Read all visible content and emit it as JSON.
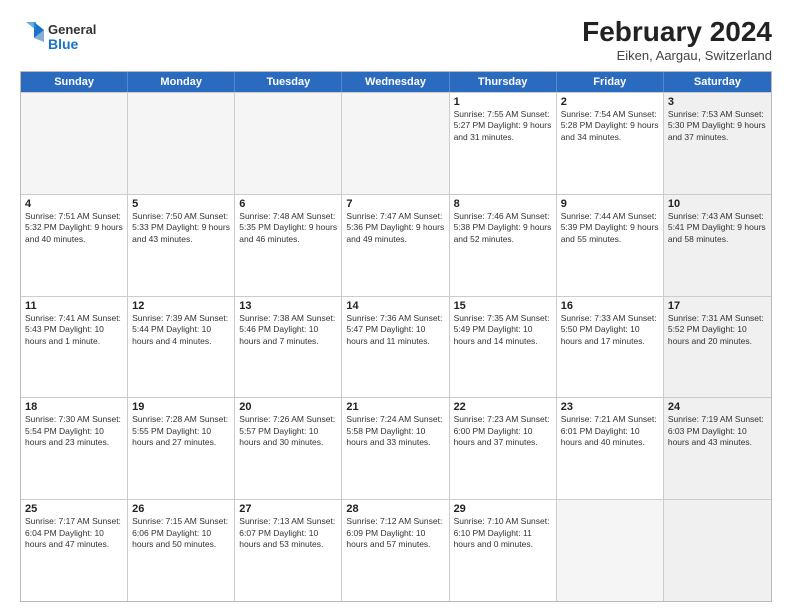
{
  "header": {
    "logo_general": "General",
    "logo_blue": "Blue",
    "month_year": "February 2024",
    "location": "Eiken, Aargau, Switzerland"
  },
  "weekdays": [
    "Sunday",
    "Monday",
    "Tuesday",
    "Wednesday",
    "Thursday",
    "Friday",
    "Saturday"
  ],
  "rows": [
    [
      {
        "day": "",
        "info": "",
        "empty": true
      },
      {
        "day": "",
        "info": "",
        "empty": true
      },
      {
        "day": "",
        "info": "",
        "empty": true
      },
      {
        "day": "",
        "info": "",
        "empty": true
      },
      {
        "day": "1",
        "info": "Sunrise: 7:55 AM\nSunset: 5:27 PM\nDaylight: 9 hours\nand 31 minutes."
      },
      {
        "day": "2",
        "info": "Sunrise: 7:54 AM\nSunset: 5:28 PM\nDaylight: 9 hours\nand 34 minutes."
      },
      {
        "day": "3",
        "info": "Sunrise: 7:53 AM\nSunset: 5:30 PM\nDaylight: 9 hours\nand 37 minutes.",
        "shaded": true
      }
    ],
    [
      {
        "day": "4",
        "info": "Sunrise: 7:51 AM\nSunset: 5:32 PM\nDaylight: 9 hours\nand 40 minutes."
      },
      {
        "day": "5",
        "info": "Sunrise: 7:50 AM\nSunset: 5:33 PM\nDaylight: 9 hours\nand 43 minutes."
      },
      {
        "day": "6",
        "info": "Sunrise: 7:48 AM\nSunset: 5:35 PM\nDaylight: 9 hours\nand 46 minutes."
      },
      {
        "day": "7",
        "info": "Sunrise: 7:47 AM\nSunset: 5:36 PM\nDaylight: 9 hours\nand 49 minutes."
      },
      {
        "day": "8",
        "info": "Sunrise: 7:46 AM\nSunset: 5:38 PM\nDaylight: 9 hours\nand 52 minutes."
      },
      {
        "day": "9",
        "info": "Sunrise: 7:44 AM\nSunset: 5:39 PM\nDaylight: 9 hours\nand 55 minutes."
      },
      {
        "day": "10",
        "info": "Sunrise: 7:43 AM\nSunset: 5:41 PM\nDaylight: 9 hours\nand 58 minutes.",
        "shaded": true
      }
    ],
    [
      {
        "day": "11",
        "info": "Sunrise: 7:41 AM\nSunset: 5:43 PM\nDaylight: 10 hours\nand 1 minute."
      },
      {
        "day": "12",
        "info": "Sunrise: 7:39 AM\nSunset: 5:44 PM\nDaylight: 10 hours\nand 4 minutes."
      },
      {
        "day": "13",
        "info": "Sunrise: 7:38 AM\nSunset: 5:46 PM\nDaylight: 10 hours\nand 7 minutes."
      },
      {
        "day": "14",
        "info": "Sunrise: 7:36 AM\nSunset: 5:47 PM\nDaylight: 10 hours\nand 11 minutes."
      },
      {
        "day": "15",
        "info": "Sunrise: 7:35 AM\nSunset: 5:49 PM\nDaylight: 10 hours\nand 14 minutes."
      },
      {
        "day": "16",
        "info": "Sunrise: 7:33 AM\nSunset: 5:50 PM\nDaylight: 10 hours\nand 17 minutes."
      },
      {
        "day": "17",
        "info": "Sunrise: 7:31 AM\nSunset: 5:52 PM\nDaylight: 10 hours\nand 20 minutes.",
        "shaded": true
      }
    ],
    [
      {
        "day": "18",
        "info": "Sunrise: 7:30 AM\nSunset: 5:54 PM\nDaylight: 10 hours\nand 23 minutes."
      },
      {
        "day": "19",
        "info": "Sunrise: 7:28 AM\nSunset: 5:55 PM\nDaylight: 10 hours\nand 27 minutes."
      },
      {
        "day": "20",
        "info": "Sunrise: 7:26 AM\nSunset: 5:57 PM\nDaylight: 10 hours\nand 30 minutes."
      },
      {
        "day": "21",
        "info": "Sunrise: 7:24 AM\nSunset: 5:58 PM\nDaylight: 10 hours\nand 33 minutes."
      },
      {
        "day": "22",
        "info": "Sunrise: 7:23 AM\nSunset: 6:00 PM\nDaylight: 10 hours\nand 37 minutes."
      },
      {
        "day": "23",
        "info": "Sunrise: 7:21 AM\nSunset: 6:01 PM\nDaylight: 10 hours\nand 40 minutes."
      },
      {
        "day": "24",
        "info": "Sunrise: 7:19 AM\nSunset: 6:03 PM\nDaylight: 10 hours\nand 43 minutes.",
        "shaded": true
      }
    ],
    [
      {
        "day": "25",
        "info": "Sunrise: 7:17 AM\nSunset: 6:04 PM\nDaylight: 10 hours\nand 47 minutes."
      },
      {
        "day": "26",
        "info": "Sunrise: 7:15 AM\nSunset: 6:06 PM\nDaylight: 10 hours\nand 50 minutes."
      },
      {
        "day": "27",
        "info": "Sunrise: 7:13 AM\nSunset: 6:07 PM\nDaylight: 10 hours\nand 53 minutes."
      },
      {
        "day": "28",
        "info": "Sunrise: 7:12 AM\nSunset: 6:09 PM\nDaylight: 10 hours\nand 57 minutes."
      },
      {
        "day": "29",
        "info": "Sunrise: 7:10 AM\nSunset: 6:10 PM\nDaylight: 11 hours\nand 0 minutes."
      },
      {
        "day": "",
        "info": "",
        "empty": true
      },
      {
        "day": "",
        "info": "",
        "empty": true,
        "shaded": true
      }
    ]
  ]
}
